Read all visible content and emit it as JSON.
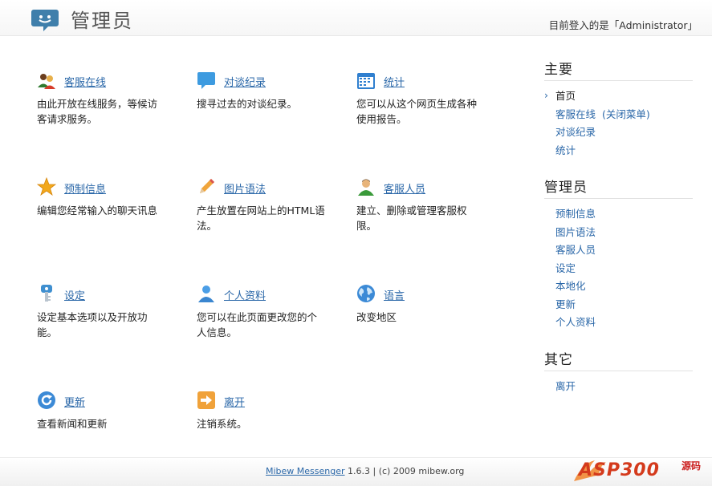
{
  "header": {
    "title": "管理员",
    "login_text": "目前登入的是「Administrator」"
  },
  "main": {
    "items": [
      {
        "label": "客服在线",
        "desc": "由此开放在线服务，等候访客请求服务。",
        "icon": "operators-online-icon"
      },
      {
        "label": "对谈纪录",
        "desc": "搜寻过去的对谈纪录。",
        "icon": "chat-bubble-icon"
      },
      {
        "label": "统计",
        "desc": "您可以从这个网页生成各种使用报告。",
        "icon": "calendar-icon"
      },
      {
        "label": "预制信息",
        "desc": "编辑您经常输入的聊天讯息",
        "icon": "star-icon"
      },
      {
        "label": "图片语法",
        "desc": "产生放置在网站上的HTML语法。",
        "icon": "pencil-icon"
      },
      {
        "label": "客服人员",
        "desc": "建立、删除或管理客服权限。",
        "icon": "user-icon"
      },
      {
        "label": "设定",
        "desc": "设定基本选项以及开放功能。",
        "icon": "settings-key-icon"
      },
      {
        "label": "个人资料",
        "desc": "您可以在此页面更改您的个人信息。",
        "icon": "profile-icon"
      },
      {
        "label": "语言",
        "desc": "改变地区",
        "icon": "globe-icon"
      },
      {
        "label": "更新",
        "desc": "查看新闻和更新",
        "icon": "refresh-icon"
      },
      {
        "label": "离开",
        "desc": "注销系统。",
        "icon": "logout-arrow-icon"
      }
    ]
  },
  "sidebar": {
    "sections": [
      {
        "title": "主要",
        "items": [
          "首页",
          "客服在线",
          "对谈纪录",
          "统计"
        ],
        "extra": "(关闭菜单)"
      },
      {
        "title": "管理员",
        "items": [
          "预制信息",
          "图片语法",
          "客服人员",
          "设定",
          "本地化",
          "更新",
          "个人资料"
        ]
      },
      {
        "title": "其它",
        "items": [
          "离开"
        ]
      }
    ]
  },
  "footer": {
    "link": "Mibew Messenger",
    "text": "1.6.3 | (c) 2009 mibew.org",
    "watermark": "ASP300",
    "watermark_cn": "源码"
  },
  "colors": {
    "link": "#2a67a8",
    "accent": "#3c8ac8"
  }
}
